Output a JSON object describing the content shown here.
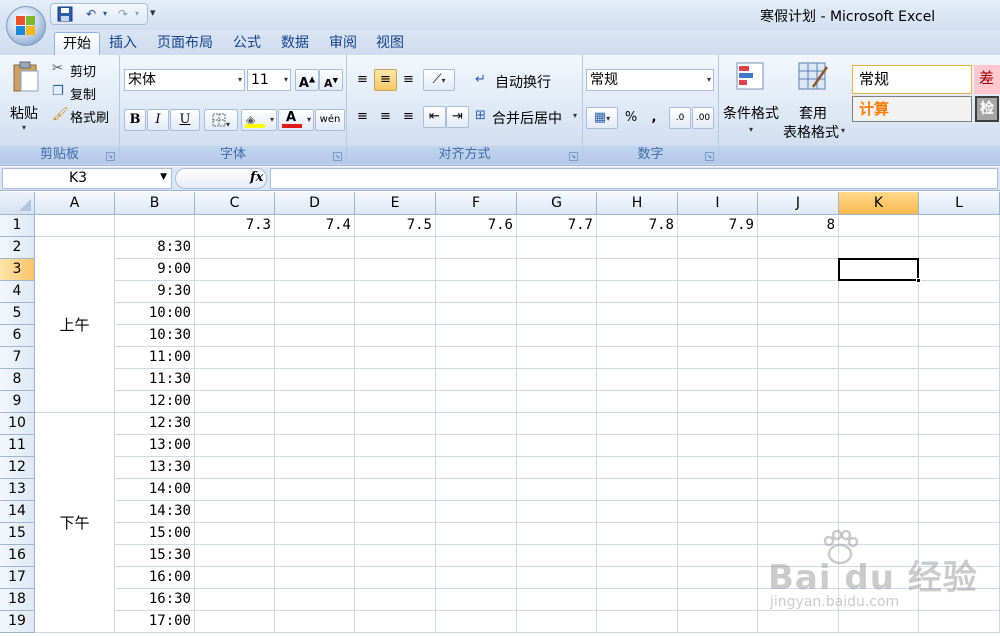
{
  "window": {
    "title": "寒假计划 - Microsoft Excel"
  },
  "tabs": [
    "开始",
    "插入",
    "页面布局",
    "公式",
    "数据",
    "审阅",
    "视图"
  ],
  "ribbon": {
    "clipboard": {
      "label": "剪贴板",
      "paste": "粘贴",
      "cut": "剪切",
      "copy": "复制",
      "format_painter": "格式刷"
    },
    "font": {
      "label": "字体",
      "font_name": "宋体",
      "font_size": "11",
      "bold": "B",
      "italic": "I",
      "underline": "U"
    },
    "alignment": {
      "label": "对齐方式",
      "wrap_text": "自动换行",
      "merge_center": "合并后居中"
    },
    "number": {
      "label": "数字",
      "format": "常规",
      "percent": "%",
      "comma": ","
    },
    "styles": {
      "conditional_format": "条件格式",
      "table_format_1": "套用",
      "table_format_2": "表格格式",
      "style_normal": "常规",
      "style_bad": "差",
      "style_calc": "计算",
      "style_check": "检"
    }
  },
  "formula_bar": {
    "name_box": "K3",
    "fx": "fx",
    "formula": ""
  },
  "sheet": {
    "columns": [
      "A",
      "B",
      "C",
      "D",
      "E",
      "F",
      "G",
      "H",
      "I",
      "J",
      "K",
      "L"
    ],
    "rows": [
      "1",
      "2",
      "3",
      "4",
      "5",
      "6",
      "7",
      "8",
      "9",
      "10",
      "11",
      "12",
      "13",
      "14",
      "15",
      "16",
      "17",
      "18",
      "19"
    ],
    "header_dates": [
      "7.3",
      "7.4",
      "7.5",
      "7.6",
      "7.7",
      "7.8",
      "7.9",
      "8"
    ],
    "times": [
      "8:30",
      "9:00",
      "9:30",
      "10:00",
      "10:30",
      "11:00",
      "11:30",
      "12:00",
      "12:30",
      "13:00",
      "13:30",
      "14:00",
      "14:30",
      "15:00",
      "15:30",
      "16:00",
      "16:30",
      "17:00"
    ],
    "morning_label": "上午",
    "afternoon_label": "下午",
    "selected_cell": "K3"
  },
  "watermark": {
    "brand": "Bai du 经验",
    "url": "jingyan.baidu.com"
  },
  "colors": {
    "accent": "#15428b",
    "selection": "#f8b84e",
    "grid_line": "#d0d7e5"
  }
}
